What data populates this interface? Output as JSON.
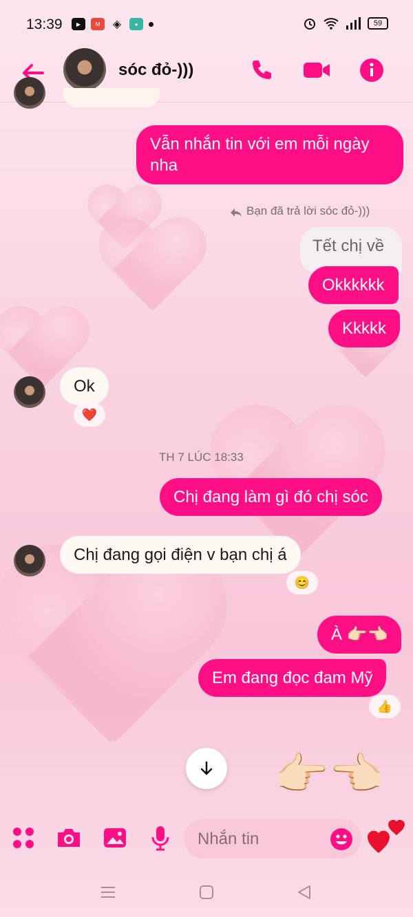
{
  "status": {
    "time": "13:39",
    "battery": "59"
  },
  "header": {
    "contact_name": "sóc đỏ-)))"
  },
  "messages": {
    "m1": "Vẫn nhắn tin với em mỗi ngày nha",
    "reply_note": "Bạn đã trả lời sóc đỏ-)))",
    "quoted": "Tết chị về",
    "m2": "Okkkkkk",
    "m3": "Kkkkk",
    "m4": "Ok",
    "timestamp": "TH 7 LÚC 18:33",
    "m5": "Chị đang làm gì đó chị sóc",
    "m6": "Chị đang gọi điện v bạn chị á",
    "m7": "À 👉🏻👈🏻",
    "m8": "Em đang đọc đam Mỹ"
  },
  "reactions": {
    "r_ok": "❤️",
    "r_m6": "😊",
    "r_m8": "👍"
  },
  "big_emoji": "👉🏻👈🏻",
  "composer": {
    "placeholder": "Nhắn tin"
  },
  "colors": {
    "accent": "#ff0f85",
    "incoming": "#fff8f3"
  },
  "icons": [
    "back-arrow-icon",
    "phone-icon",
    "video-icon",
    "info-icon",
    "apps-icon",
    "camera-icon",
    "gallery-icon",
    "mic-icon",
    "emoji-icon",
    "heart-icon",
    "down-arrow-icon"
  ]
}
